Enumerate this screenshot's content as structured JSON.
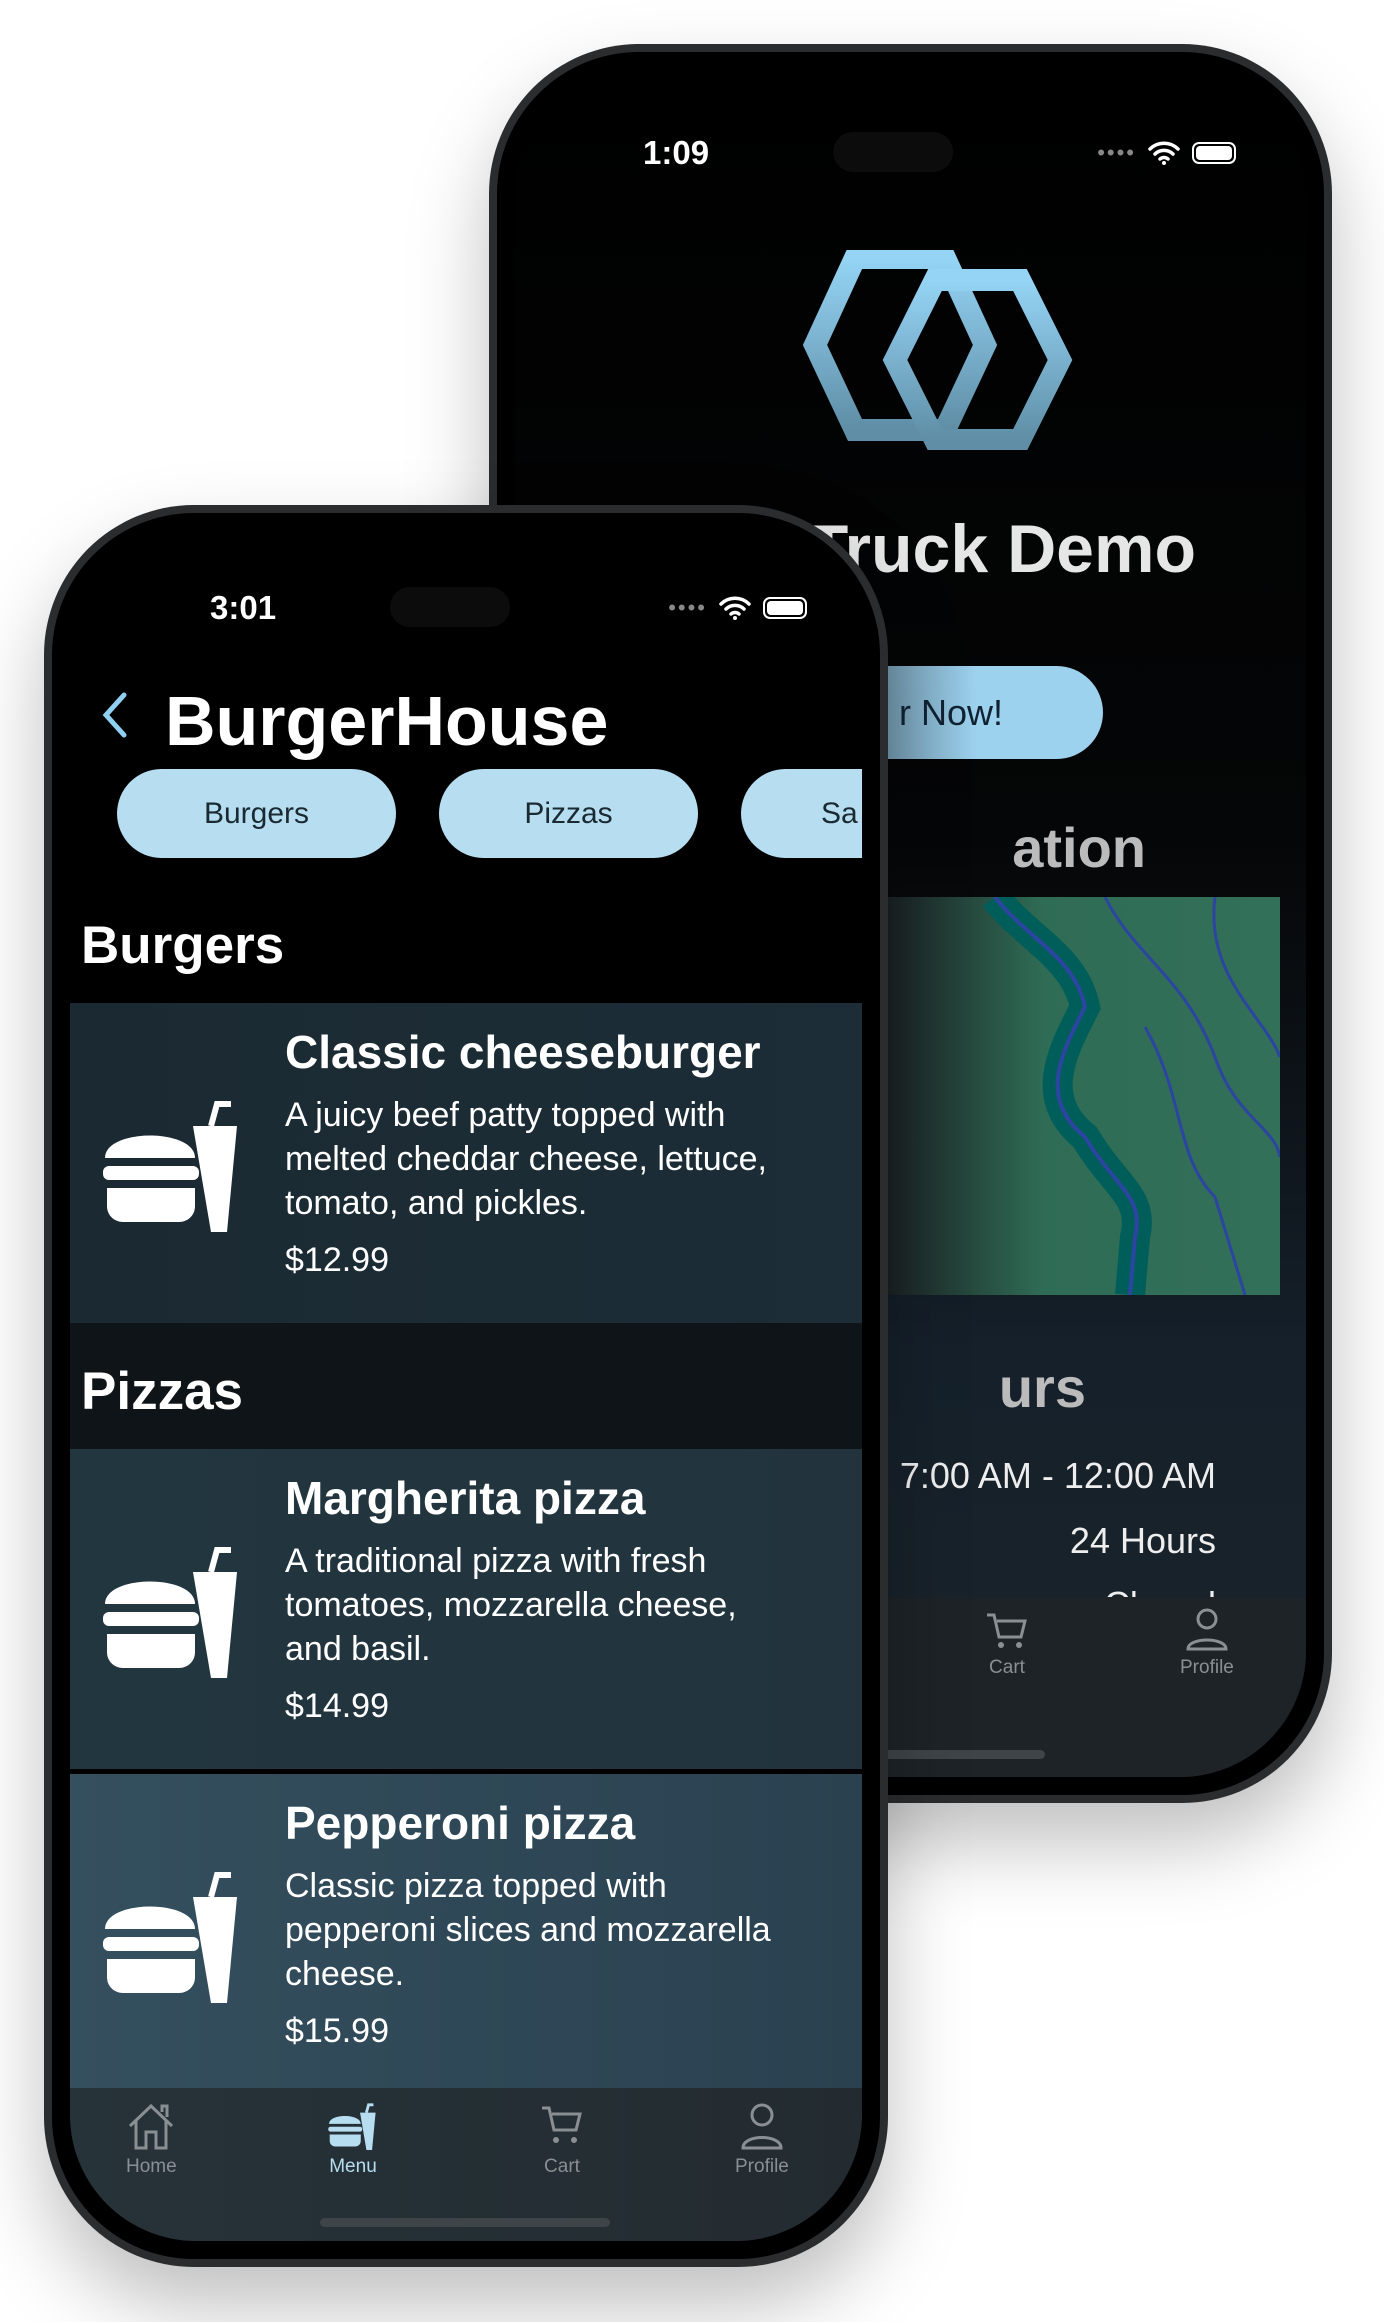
{
  "back_phone": {
    "status_time": "1:09",
    "title": "Truck Demo",
    "order_button": "r Now!",
    "location_heading": "ation",
    "hours_heading": "urs",
    "hours": [
      "7:00 AM - 12:00 AM",
      "24 Hours",
      "Closed"
    ],
    "tabs": [
      {
        "label": "Cart",
        "icon": "cart-icon"
      },
      {
        "label": "Profile",
        "icon": "profile-icon"
      }
    ]
  },
  "front_phone": {
    "status_time": "3:01",
    "title": "BurgerHouse",
    "chips": [
      "Burgers",
      "Pizzas",
      "Sa"
    ],
    "sections": [
      {
        "heading": "Burgers",
        "items": [
          {
            "name": "Classic cheeseburger",
            "desc": [
              "A juicy beef patty topped with",
              "melted cheddar cheese, lettuce,",
              "tomato, and pickles."
            ],
            "price": "$12.99"
          }
        ]
      },
      {
        "heading": "Pizzas",
        "items": [
          {
            "name": "Margherita pizza",
            "desc": [
              "A traditional pizza with fresh",
              "tomatoes, mozzarella cheese,",
              "and basil."
            ],
            "price": "$14.99"
          },
          {
            "name": "Pepperoni pizza",
            "desc": [
              "Classic pizza topped with",
              "pepperoni slices and mozzarella",
              "cheese."
            ],
            "price": "$15.99"
          }
        ]
      }
    ],
    "tabs": [
      {
        "label": "Home",
        "icon": "home-icon"
      },
      {
        "label": "Menu",
        "icon": "burger-drink-icon",
        "active": true
      },
      {
        "label": "Cart",
        "icon": "cart-icon"
      },
      {
        "label": "Profile",
        "icon": "profile-icon"
      }
    ]
  },
  "colors": {
    "accent": "#b6def0",
    "logo": "#8fd0f2",
    "map_green": "#33705a"
  }
}
